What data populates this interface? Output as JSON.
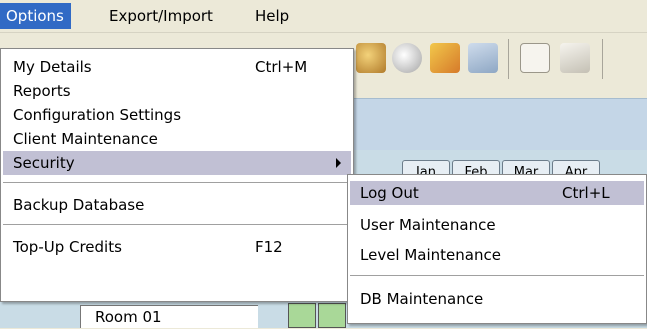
{
  "menubar": {
    "items": [
      {
        "label": "Options"
      },
      {
        "label": "Export/Import"
      },
      {
        "label": "Help"
      }
    ]
  },
  "options_menu": {
    "items": [
      {
        "label": "My Details",
        "shortcut": "Ctrl+M"
      },
      {
        "label": "Reports",
        "shortcut": ""
      },
      {
        "label": "Configuration Settings",
        "shortcut": ""
      },
      {
        "label": "Client Maintenance",
        "shortcut": ""
      },
      {
        "label": "Security",
        "shortcut": "",
        "has_submenu": true
      },
      {
        "label": "Backup Database",
        "shortcut": ""
      },
      {
        "label": "Top-Up Credits",
        "shortcut": "F12"
      }
    ]
  },
  "security_submenu": {
    "items": [
      {
        "label": "Log Out",
        "shortcut": "Ctrl+L"
      },
      {
        "label": "User Maintenance",
        "shortcut": ""
      },
      {
        "label": "Level Maintenance",
        "shortcut": ""
      },
      {
        "label": "DB Maintenance",
        "shortcut": ""
      }
    ]
  },
  "background": {
    "month_tabs": [
      "Jan",
      "Feb",
      "Mar",
      "Apr"
    ],
    "room_label": "Room 01"
  },
  "colors": {
    "menubar_active": "#316ac5",
    "menu_highlight": "#c1c0d4",
    "menu_background": "#ffffff",
    "app_background": "#ece9d8"
  }
}
